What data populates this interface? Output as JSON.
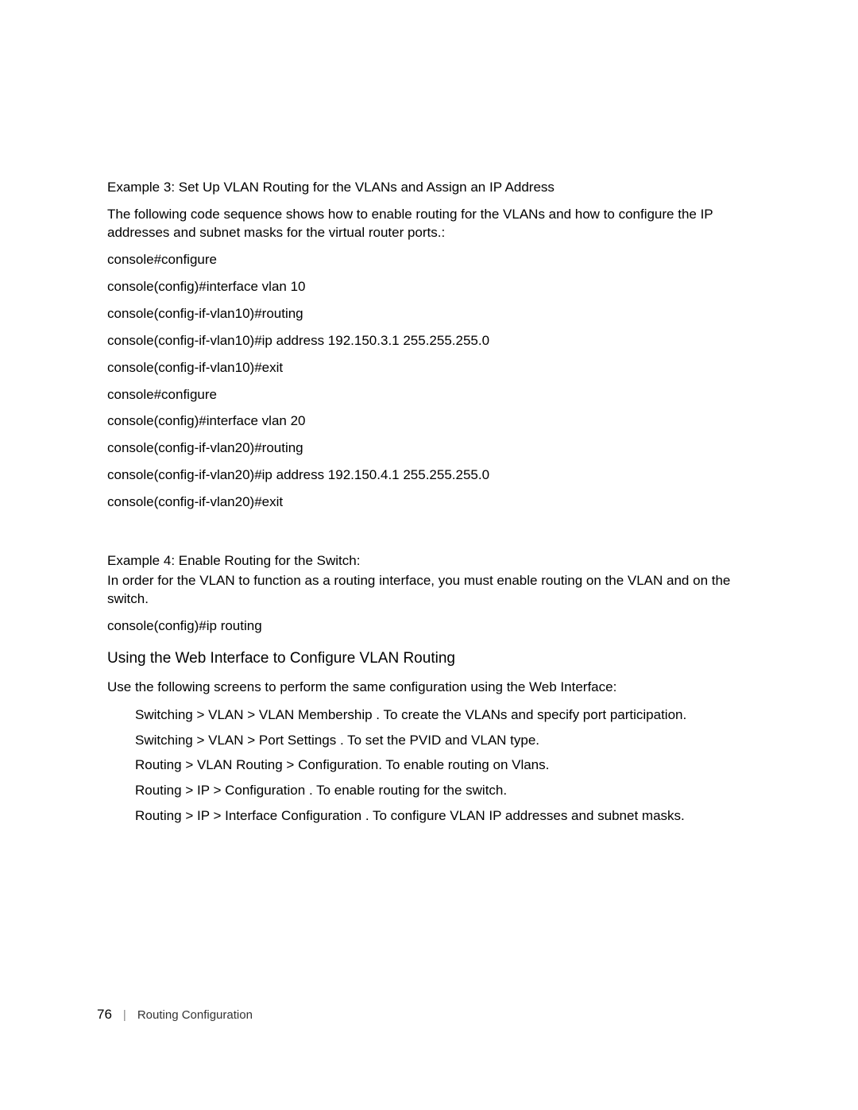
{
  "example3": {
    "title": "Example 3: Set Up VLAN Routing for the VLANs and Assign an IP Address",
    "intro": "The following code sequence shows how to enable routing for the VLANs and how to configure the IP addresses and subnet masks for the virtual router ports.:",
    "lines": [
      "console#configure",
      "console(config)#interface vlan 10",
      "console(config-if-vlan10)#routing",
      "console(config-if-vlan10)#ip address 192.150.3.1 255.255.255.0",
      "console(config-if-vlan10)#exit",
      "console#configure",
      "console(config)#interface vlan 20",
      "console(config-if-vlan20)#routing",
      "console(config-if-vlan20)#ip address 192.150.4.1 255.255.255.0",
      "console(config-if-vlan20)#exit"
    ]
  },
  "example4": {
    "title": "Example 4: Enable Routing for the Switch:",
    "intro": "In order for the VLAN to function as a routing interface, you must enable routing on the VLAN and on the switch.",
    "line": "console(config)#ip routing"
  },
  "web_section": {
    "heading": "Using the Web Interface to Configure VLAN Routing",
    "intro": "Use the following screens to perform the same configuration using the Web Interface:",
    "items": [
      "Switching > VLAN > VLAN Membership  . To create the VLANs and specify port participation.",
      "Switching > VLAN > Port Settings . To set the PVID and VLAN type.",
      "Routing > VLAN Routing > Configuration.    To enable routing on Vlans.",
      "Routing > IP > Configuration  . To enable routing for the switch.",
      "Routing > IP > Interface Configuration  . To configure VLAN IP addresses and subnet masks."
    ]
  },
  "footer": {
    "page_number": "76",
    "divider": "|",
    "section": "Routing Configuration"
  }
}
